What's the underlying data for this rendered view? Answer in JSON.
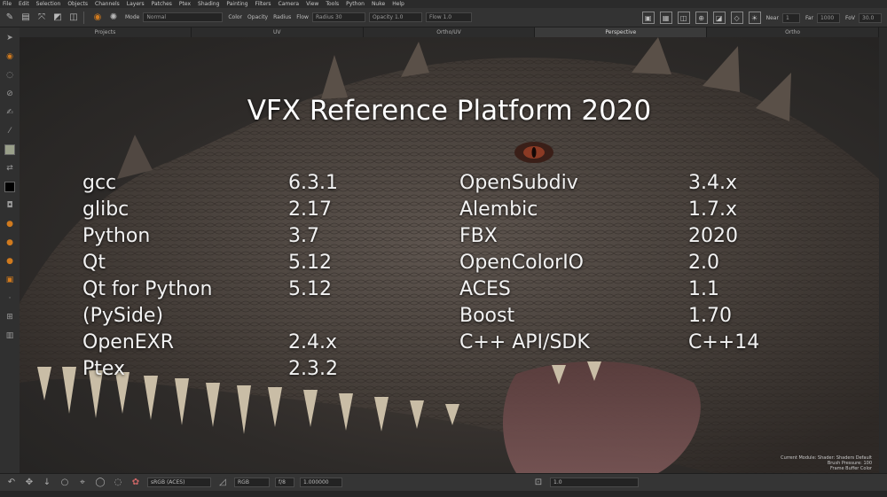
{
  "menubar": {
    "items": [
      "File",
      "Edit",
      "Selection",
      "Objects",
      "Channels",
      "Layers",
      "Patches",
      "Ptex",
      "Shading",
      "Painting",
      "Filters",
      "Camera",
      "View",
      "Tools",
      "Python",
      "Nuke",
      "Help"
    ]
  },
  "toolbar": {
    "mode_label": "Mode",
    "mode_value": "Normal",
    "color_label": "Color",
    "opacity_label": "Opacity",
    "radius_label": "Radius",
    "flow_label": "Flow",
    "radius_field_label": "Radius",
    "radius_value": "30",
    "opacity_field_label": "Opacity",
    "opacity_value": "1.0",
    "flow_field_label": "Flow",
    "flow_value": "1.0",
    "near_label": "Near",
    "near_value": "1",
    "far_label": "Far",
    "far_value": "1000",
    "fov_label": "FoV",
    "fov_value": "30.0"
  },
  "tabs": [
    {
      "label": "Projects",
      "active": false
    },
    {
      "label": "UV",
      "active": false
    },
    {
      "label": "Ortho/UV",
      "active": false
    },
    {
      "label": "Perspective",
      "active": true
    },
    {
      "label": "Ortho",
      "active": false
    }
  ],
  "slide": {
    "title": "VFX Reference Platform 2020",
    "left_table": [
      {
        "name": "gcc",
        "version": "6.3.1"
      },
      {
        "name": "glibc",
        "version": "2.17"
      },
      {
        "name": "Python",
        "version": "3.7"
      },
      {
        "name": "Qt",
        "version": "5.12"
      },
      {
        "name": "Qt for Python",
        "version": "5.12"
      },
      {
        "name": "(PySide)",
        "version": ""
      },
      {
        "name": "OpenEXR",
        "version": "2.4.x"
      },
      {
        "name": "Ptex",
        "version": "2.3.2"
      }
    ],
    "right_table": [
      {
        "name": "OpenSubdiv",
        "version": "3.4.x"
      },
      {
        "name": "Alembic",
        "version": "1.7.x"
      },
      {
        "name": "FBX",
        "version": "2020"
      },
      {
        "name": "OpenColorIO",
        "version": "2.0"
      },
      {
        "name": "ACES",
        "version": "1.1"
      },
      {
        "name": "Boost",
        "version": "1.70"
      },
      {
        "name": "C++ API/SDK",
        "version": "C++14"
      }
    ]
  },
  "viewport_info": {
    "line1": "Current Module: Shader: Shaders Default",
    "line2": "Brush Pressure: 100",
    "line3": "Frame Buffer Color"
  },
  "bottombar": {
    "colorspace": "sRGB (ACES)",
    "channel": "RGB",
    "exposure_label": "f/8",
    "gain_value": "1.000000",
    "zoom_value": "1.0"
  },
  "colors": {
    "accent_orange": "#d07a1e",
    "slide_text": "#ffffff",
    "ui_background": "#333333"
  }
}
